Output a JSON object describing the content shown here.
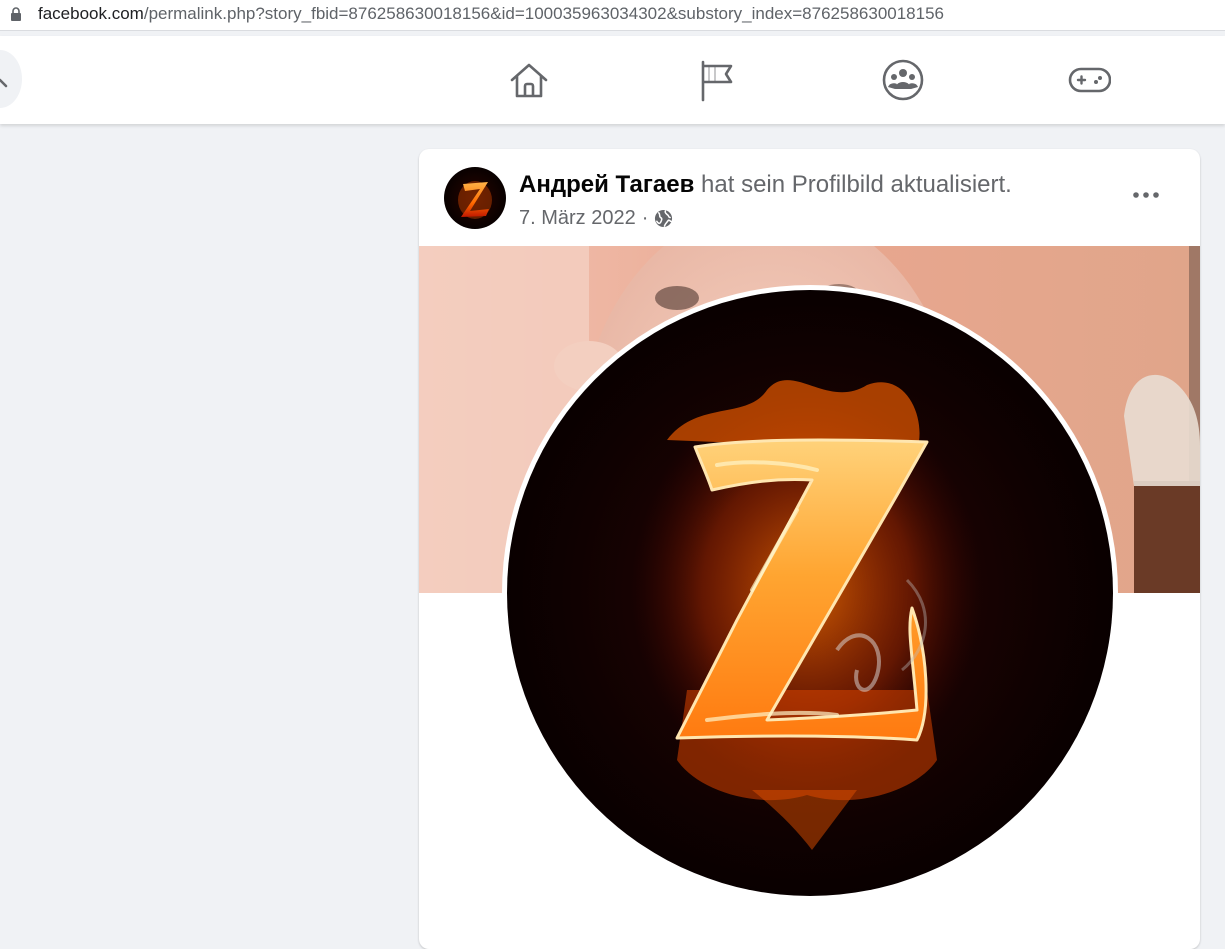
{
  "browser": {
    "url_host": "facebook.com",
    "url_rest": "/permalink.php?story_fbid=876258630018156&id=100035963034302&substory_index=876258630018156"
  },
  "nav": {
    "icons": [
      "home-icon",
      "flag-icon",
      "groups-icon",
      "gaming-icon"
    ]
  },
  "post": {
    "author": "Андрей Тагаев",
    "action": "hat sein Profilbild aktualisiert.",
    "date": "7. März 2022",
    "separator": "·",
    "audience_icon": "globe-icon",
    "more_icon": "more-options-icon"
  },
  "colors": {
    "background": "#f0f2f5",
    "text_primary": "#050505",
    "text_secondary": "#65676b",
    "icon": "#65676b"
  }
}
